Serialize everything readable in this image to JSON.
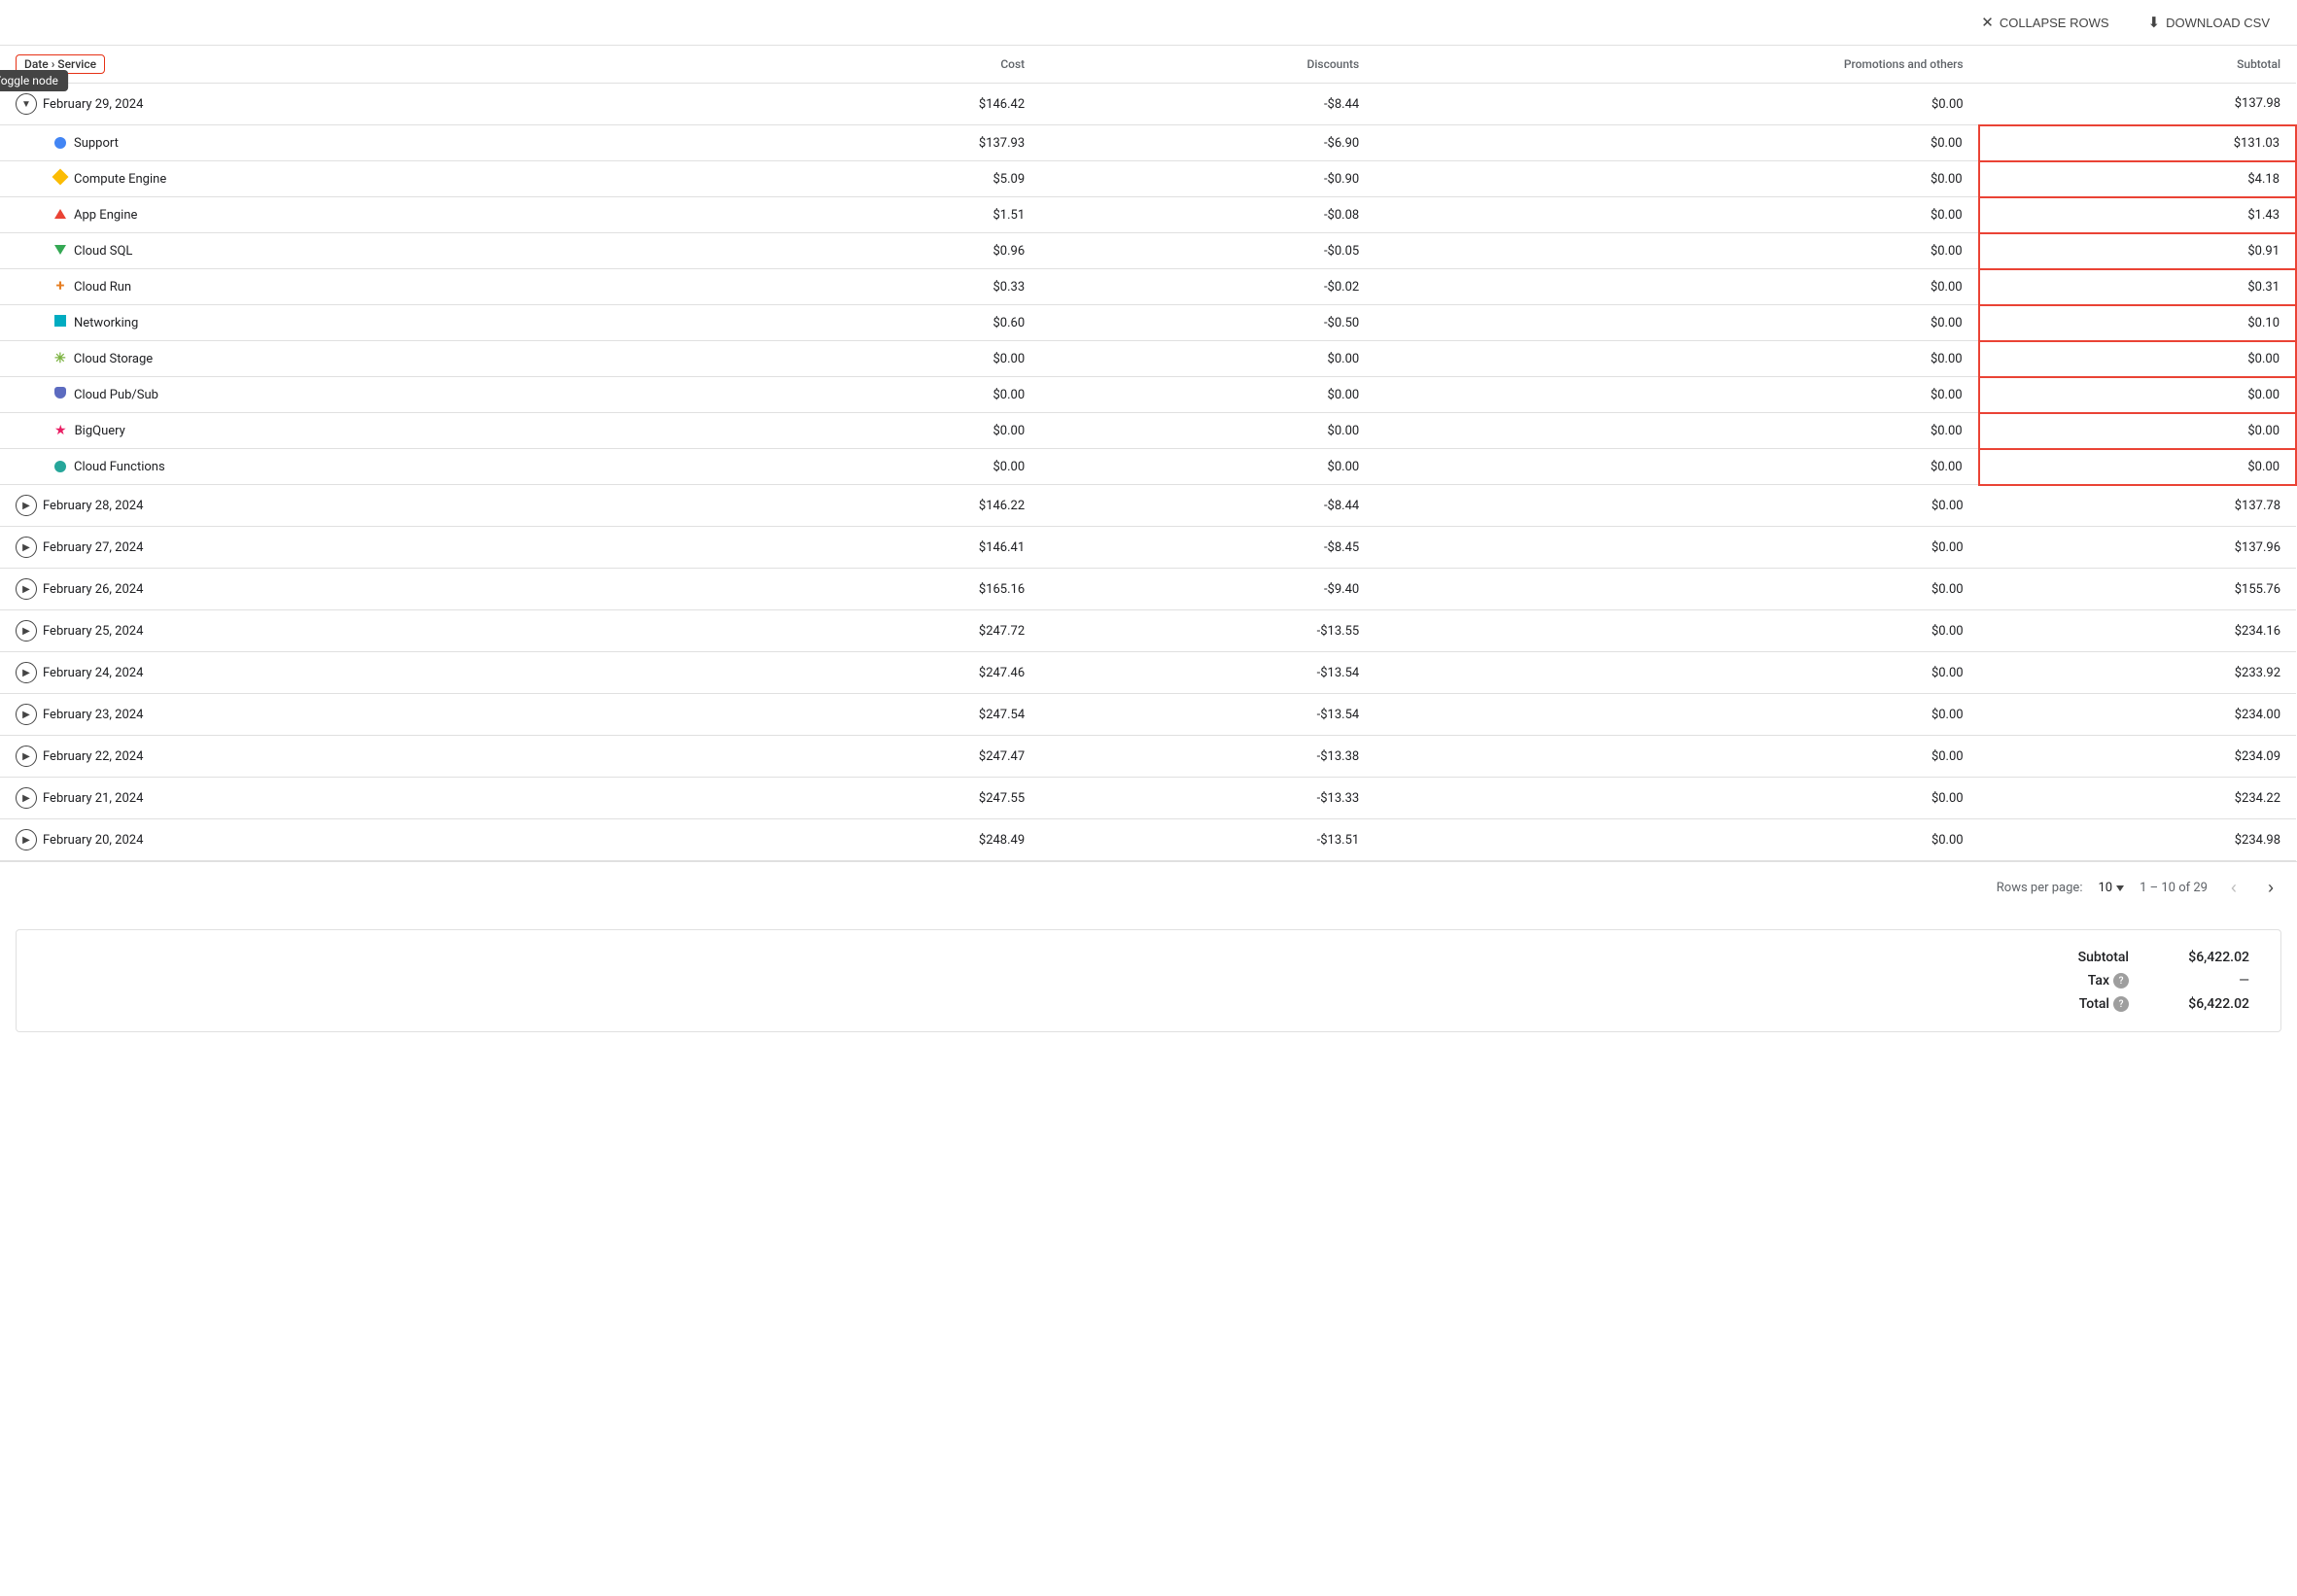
{
  "toolbar": {
    "collapse_rows_label": "COLLAPSE ROWS",
    "download_csv_label": "DOWNLOAD CSV"
  },
  "table": {
    "columns": [
      {
        "key": "date_service",
        "label": "Date › Service",
        "align": "left"
      },
      {
        "key": "cost",
        "label": "Cost",
        "align": "right"
      },
      {
        "key": "discounts",
        "label": "Discounts",
        "align": "right"
      },
      {
        "key": "promotions",
        "label": "Promotions and others",
        "align": "right"
      },
      {
        "key": "subtotal",
        "label": "Subtotal",
        "align": "right"
      }
    ],
    "expanded_date": {
      "date": "February 29, 2024",
      "cost": "$146.42",
      "discounts": "-$8.44",
      "promotions": "$0.00",
      "subtotal": "$137.98",
      "services": [
        {
          "name": "Support",
          "icon": "circle",
          "color": "#4285f4",
          "cost": "$137.93",
          "discounts": "-$6.90",
          "promotions": "$0.00",
          "subtotal": "$131.03"
        },
        {
          "name": "Compute Engine",
          "icon": "diamond",
          "color": "#fbbc04",
          "cost": "$5.09",
          "discounts": "-$0.90",
          "promotions": "$0.00",
          "subtotal": "$4.18"
        },
        {
          "name": "App Engine",
          "icon": "triangle-up",
          "color": "#ea4335",
          "cost": "$1.51",
          "discounts": "-$0.08",
          "promotions": "$0.00",
          "subtotal": "$1.43"
        },
        {
          "name": "Cloud SQL",
          "icon": "triangle-down",
          "color": "#34a853",
          "cost": "$0.96",
          "discounts": "-$0.05",
          "promotions": "$0.00",
          "subtotal": "$0.91"
        },
        {
          "name": "Cloud Run",
          "icon": "plus",
          "color": "#e67e22",
          "cost": "$0.33",
          "discounts": "-$0.02",
          "promotions": "$0.00",
          "subtotal": "$0.31"
        },
        {
          "name": "Networking",
          "icon": "square",
          "color": "#00acc1",
          "cost": "$0.60",
          "discounts": "-$0.50",
          "promotions": "$0.00",
          "subtotal": "$0.10"
        },
        {
          "name": "Cloud Storage",
          "icon": "asterisk",
          "color": "#7cb342",
          "cost": "$0.00",
          "discounts": "$0.00",
          "promotions": "$0.00",
          "subtotal": "$0.00"
        },
        {
          "name": "Cloud Pub/Sub",
          "icon": "shield",
          "color": "#5c6bc0",
          "cost": "$0.00",
          "discounts": "$0.00",
          "promotions": "$0.00",
          "subtotal": "$0.00"
        },
        {
          "name": "BigQuery",
          "icon": "star",
          "color": "#e91e63",
          "cost": "$0.00",
          "discounts": "$0.00",
          "promotions": "$0.00",
          "subtotal": "$0.00"
        },
        {
          "name": "Cloud Functions",
          "icon": "circle",
          "color": "#26a69a",
          "cost": "$0.00",
          "discounts": "$0.00",
          "promotions": "$0.00",
          "subtotal": "$0.00"
        }
      ]
    },
    "collapsed_dates": [
      {
        "date": "February 28, 2024",
        "cost": "$146.22",
        "discounts": "-$8.44",
        "promotions": "$0.00",
        "subtotal": "$137.78"
      },
      {
        "date": "February 27, 2024",
        "cost": "$146.41",
        "discounts": "-$8.45",
        "promotions": "$0.00",
        "subtotal": "$137.96"
      },
      {
        "date": "February 26, 2024",
        "cost": "$165.16",
        "discounts": "-$9.40",
        "promotions": "$0.00",
        "subtotal": "$155.76"
      },
      {
        "date": "February 25, 2024",
        "cost": "$247.72",
        "discounts": "-$13.55",
        "promotions": "$0.00",
        "subtotal": "$234.16"
      },
      {
        "date": "February 24, 2024",
        "cost": "$247.46",
        "discounts": "-$13.54",
        "promotions": "$0.00",
        "subtotal": "$233.92"
      },
      {
        "date": "February 23, 2024",
        "cost": "$247.54",
        "discounts": "-$13.54",
        "promotions": "$0.00",
        "subtotal": "$234.00"
      },
      {
        "date": "February 22, 2024",
        "cost": "$247.47",
        "discounts": "-$13.38",
        "promotions": "$0.00",
        "subtotal": "$234.09"
      },
      {
        "date": "February 21, 2024",
        "cost": "$247.55",
        "discounts": "-$13.33",
        "promotions": "$0.00",
        "subtotal": "$234.22"
      },
      {
        "date": "February 20, 2024",
        "cost": "$248.49",
        "discounts": "-$13.51",
        "promotions": "$0.00",
        "subtotal": "$234.98"
      }
    ]
  },
  "pagination": {
    "rows_per_page_label": "Rows per page:",
    "current_rows": "10",
    "page_info": "1 – 10 of 29"
  },
  "summary": {
    "subtotal_label": "Subtotal",
    "subtotal_value": "$6,422.02",
    "tax_label": "Tax",
    "tax_value": "—",
    "total_label": "Total",
    "total_value": "$6,422.02"
  },
  "tooltip": {
    "toggle_node": "Toggle node"
  }
}
